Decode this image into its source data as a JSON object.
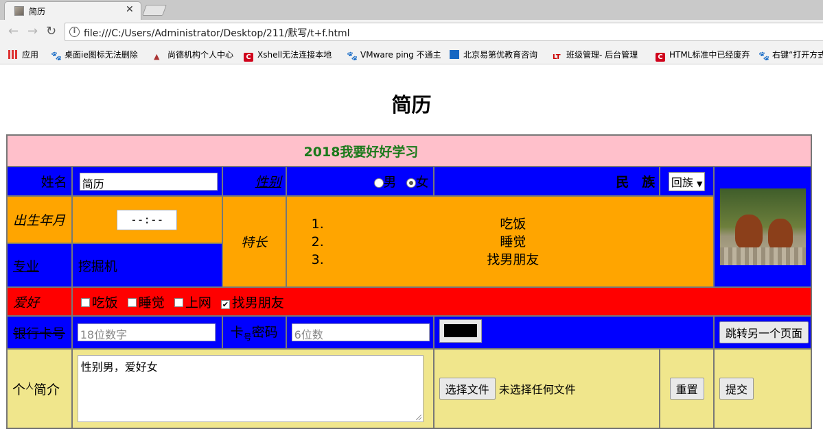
{
  "browser": {
    "tab_title": "简历",
    "url": "file:///C:/Users/Administrator/Desktop/211/默写/t+f.html",
    "bookmarks": [
      {
        "label": "应用",
        "icon": "apps-icon"
      },
      {
        "label": "桌面ie图标无法删除",
        "icon": "baidu-paw-icon"
      },
      {
        "label": "尚德机构个人中心",
        "icon": "bird-icon"
      },
      {
        "label": "Xshell无法连接本地",
        "icon": "csdn-icon"
      },
      {
        "label": "VMware ping 不通主",
        "icon": "baidu-paw-icon"
      },
      {
        "label": "北京易第优教育咨询",
        "icon": "box-icon"
      },
      {
        "label": "班级管理- 后台管理",
        "icon": "lt-icon"
      },
      {
        "label": "HTML标准中已经废弃",
        "icon": "csdn-icon"
      },
      {
        "label": "右键“打开方式",
        "icon": "baidu-paw-icon"
      }
    ]
  },
  "page": {
    "title": "简历",
    "table_caption": "2018我要好好学习",
    "colors": {
      "header_bg": "#ffc0cb",
      "blue_bg": "#0000ff",
      "orange_bg": "#ffa500",
      "red_bg": "#ff0000",
      "khaki_bg": "#f0e68c",
      "caption_text": "#1a7a1a"
    },
    "name": {
      "label": "姓名",
      "value": "简历"
    },
    "gender": {
      "label": "性别",
      "options": [
        "男",
        "女"
      ],
      "selected": "女"
    },
    "ethnicity": {
      "label": "民　族",
      "selected": "回族"
    },
    "birth": {
      "label": "出生年月",
      "placeholder": "--:--"
    },
    "specialty": {
      "label": "特长",
      "items": [
        "吃饭",
        "睡觉",
        "找男朋友"
      ]
    },
    "major": {
      "label": "专业",
      "value": "挖掘机"
    },
    "photo": {
      "alt": "two puppies on a log"
    },
    "hobby": {
      "label": "爱好",
      "items": [
        {
          "label": "吃饭",
          "checked": false
        },
        {
          "label": "睡觉",
          "checked": false
        },
        {
          "label": "上网",
          "checked": false
        },
        {
          "label": "找男朋友",
          "checked": true
        }
      ]
    },
    "card": {
      "label": "银行卡号",
      "placeholder": "18位数字"
    },
    "password": {
      "label_main": "卡",
      "label_sub": "号",
      "label_tail": "密码",
      "placeholder": "6位数"
    },
    "color_picker": {
      "value": "#000000"
    },
    "jump_button": "跳转另一个页面",
    "bio": {
      "label": "个人简介",
      "label_a": "个",
      "label_sup": "人",
      "label_b": "简介",
      "value": "性别男，爱好女"
    },
    "file": {
      "button": "选择文件",
      "status": "未选择任何文件"
    },
    "reset_button": "重置",
    "submit_button": "提交"
  }
}
